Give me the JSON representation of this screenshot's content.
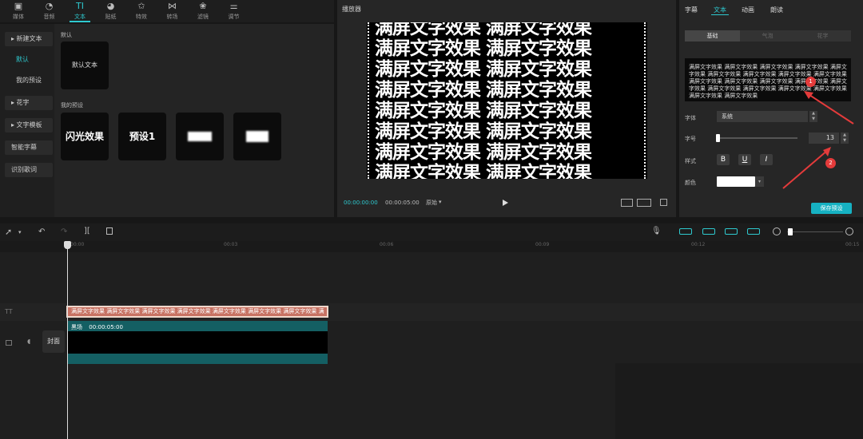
{
  "toolbar": {
    "items": [
      {
        "label": "媒体",
        "icon": "media-icon",
        "glyph": "▣"
      },
      {
        "label": "音频",
        "icon": "audio-icon",
        "glyph": "◔"
      },
      {
        "label": "文本",
        "icon": "text-icon",
        "glyph": "TI"
      },
      {
        "label": "贴纸",
        "icon": "sticker-icon",
        "glyph": "◕"
      },
      {
        "label": "特效",
        "icon": "effects-icon",
        "glyph": "✩"
      },
      {
        "label": "转场",
        "icon": "transition-icon",
        "glyph": "⋈"
      },
      {
        "label": "滤镜",
        "icon": "filter-icon",
        "glyph": "❀"
      },
      {
        "label": "调节",
        "icon": "adjust-icon",
        "glyph": "⚌"
      }
    ],
    "active": "文本"
  },
  "left_nav": {
    "new_text": "▸ 新建文本",
    "default": "默认",
    "my_presets": "我的预设",
    "huazi": "▸ 花字",
    "templates": "▸ 文字模板",
    "smart_captions": "智能字幕",
    "recognize_lyrics": "识别歌词"
  },
  "presets": {
    "default_heading": "默认",
    "default_card": "默认文本",
    "my_heading": "我的预设",
    "cards": [
      "闪光效果",
      "预设1",
      "",
      ""
    ]
  },
  "player": {
    "title": "播放器",
    "overlay_text": "满屏文字效果 满屏文字效果",
    "current_time": "00:00:00:00",
    "total_time": "00:00:05:00",
    "ratio": "原始",
    "ratio_caret": "▾"
  },
  "inspector": {
    "tabs": [
      "字幕",
      "文本",
      "动画",
      "朗读"
    ],
    "active_tab": "文本",
    "segments": [
      "基础",
      "气泡",
      "花字"
    ],
    "text_content": "满屏文字效果 满屏文字效果 满屏文字效果 满屏文字效果 满屏文字效果 满屏文字效果 满屏文字效果 满屏文字效果 满屏文字效果 满屏文字效果 满屏文字效果 满屏文字效果 满屏文字效果 满屏文字效果 满屏文字效果 满屏文字效果 满屏文字效果 满屏文字效果 满屏文字效果 满屏文字效果",
    "font_label": "字体",
    "font_value": "系统",
    "size_label": "字号",
    "size_value": "13",
    "style_label": "样式",
    "style_buttons": [
      "B",
      "U",
      "I"
    ],
    "color_label": "颜色",
    "save_preset": "保存预设",
    "badge1": "1",
    "badge2": "2",
    "accent": "#2ec9cf",
    "annotation_color": "#e43b3b"
  },
  "timeline": {
    "ticks": [
      "00:00",
      "00:03",
      "00:06",
      "00:09",
      "00:12",
      "00:15"
    ],
    "text_clip": "满屏文字效果 满屏文字效果 满屏文字效果 满屏文字效果 满屏文字效果 满屏文字效果 满屏文字效果 满",
    "video_clip_name": "黑场",
    "video_clip_duration": "00:00:05:00",
    "cover_label": "封面",
    "text_track_icon": "TT"
  }
}
